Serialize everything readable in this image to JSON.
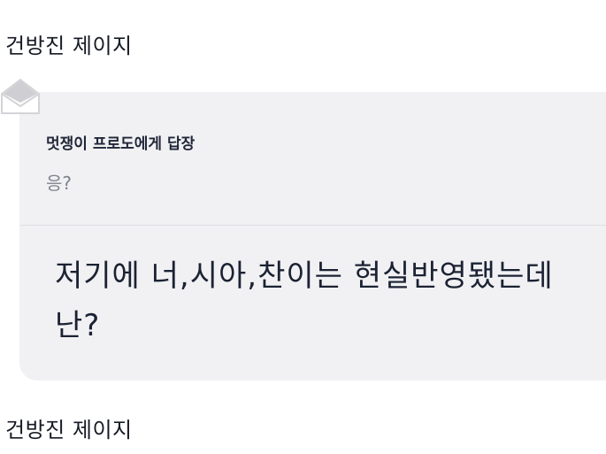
{
  "messages": {
    "sender_top": "건방진 제이지",
    "sender_bottom": "건방진 제이지"
  },
  "reply": {
    "reply_to_label": "멋쟁이 프로도에게 답장",
    "quoted_text": "응?",
    "body_line1": "저기에 너,시아,찬이는 현실반영됐는데",
    "body_line2": "난?"
  },
  "icons": {
    "reply_icon": "envelope-icon"
  },
  "colors": {
    "bubble_background": "#f1f1f3",
    "text_dark": "#1b2233",
    "quoted_gray": "#7d828d"
  }
}
